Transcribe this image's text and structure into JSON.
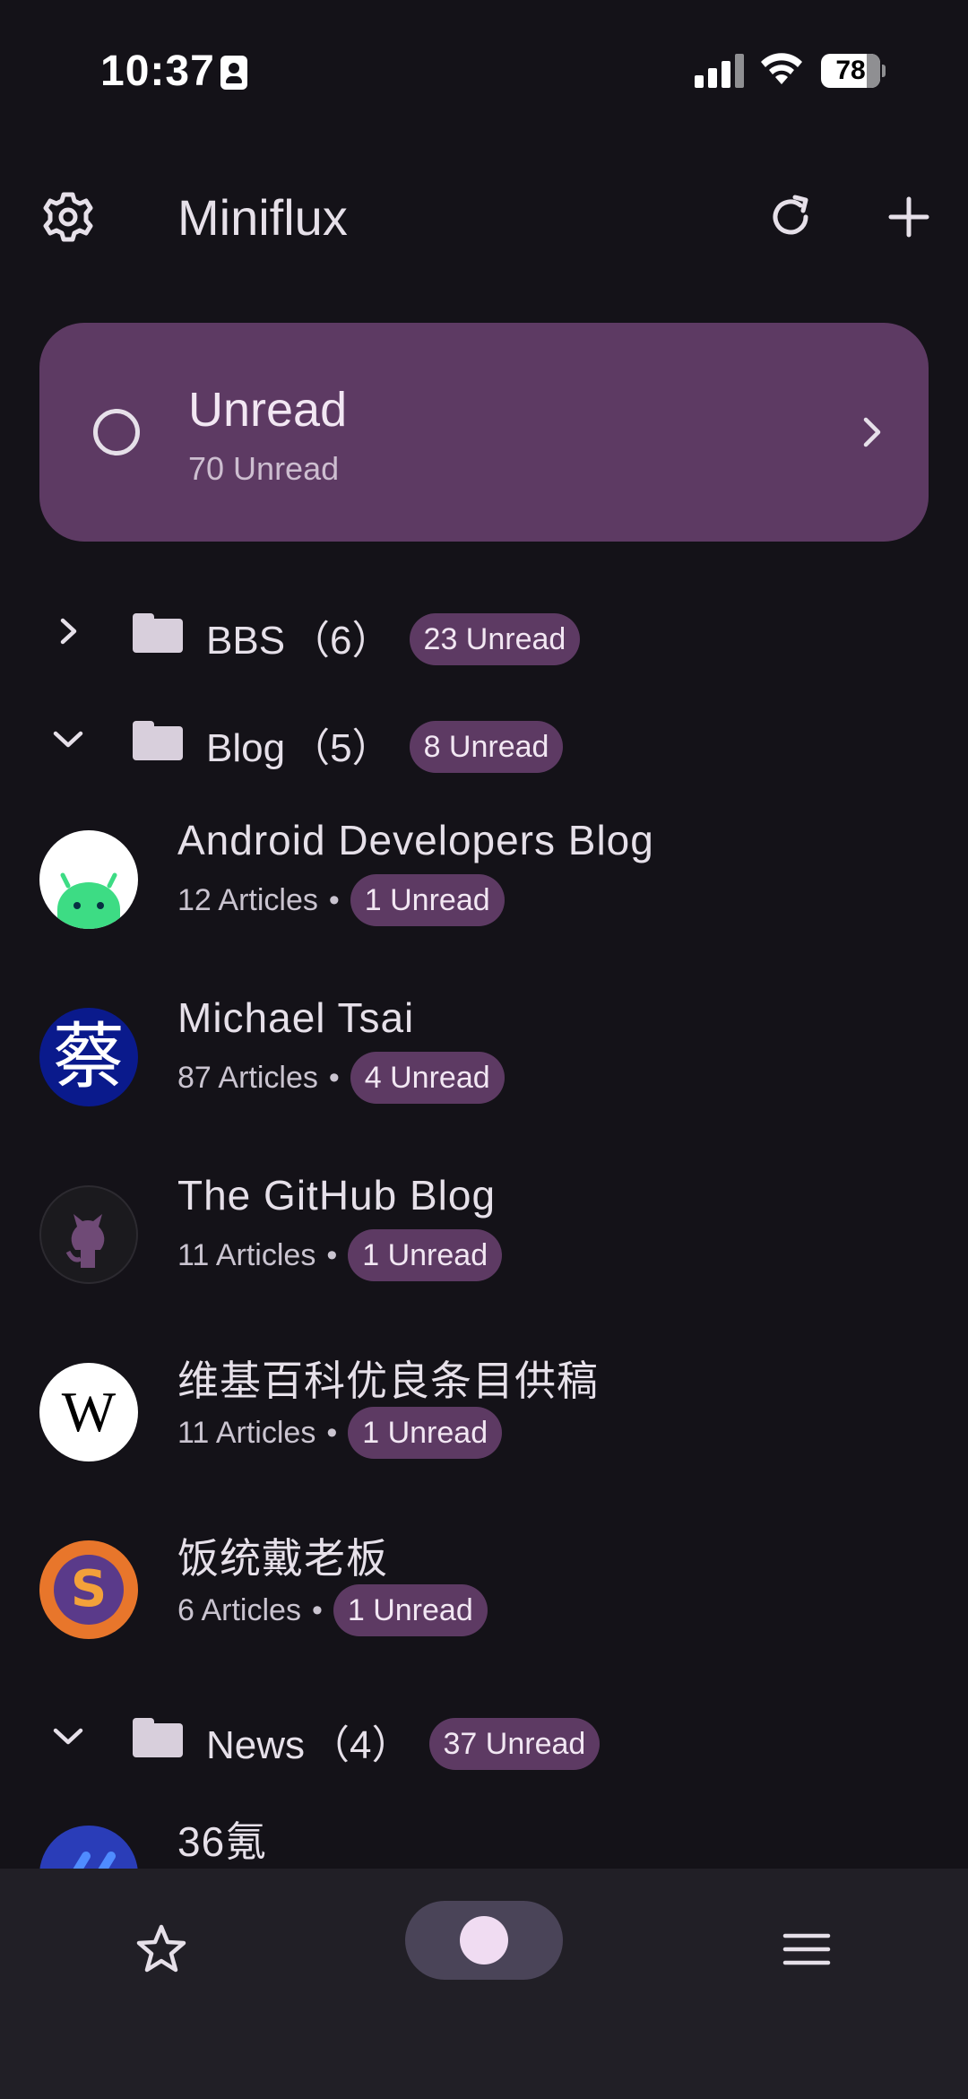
{
  "status_bar": {
    "time": "10:37",
    "battery": "78"
  },
  "app_bar": {
    "title": "Miniflux"
  },
  "unread_card": {
    "title": "Unread",
    "subtitle": "70 Unread"
  },
  "folders": [
    {
      "name": "BBS",
      "count": "（6）",
      "badge": "23 Unread"
    },
    {
      "name": "Blog",
      "count": "（5）",
      "badge": "8 Unread"
    },
    {
      "name": "News",
      "count": "（4）",
      "badge": "37 Unread"
    }
  ],
  "feeds": [
    {
      "title": "Android Developers Blog",
      "articles": "12 Articles",
      "unread": "1 Unread",
      "avatar": "android-icon"
    },
    {
      "title": "Michael Tsai",
      "articles": "87 Articles",
      "unread": "4 Unread",
      "avatar": "蔡"
    },
    {
      "title": "The GitHub Blog",
      "articles": "11 Articles",
      "unread": "1 Unread",
      "avatar": "github-icon"
    },
    {
      "title": "维基百科优良条目供稿",
      "articles": "11 Articles",
      "unread": "1 Unread",
      "avatar": "W"
    },
    {
      "title": "饭统戴老板",
      "articles": "6 Articles",
      "unread": "1 Unread",
      "avatar": "S"
    },
    {
      "title": "36氪",
      "articles": "",
      "unread": "",
      "avatar": "36kr-icon"
    }
  ],
  "separator": "•",
  "colors": {
    "background": "#141218",
    "accent": "#5d3a63",
    "bottom_bar": "#211f26"
  }
}
